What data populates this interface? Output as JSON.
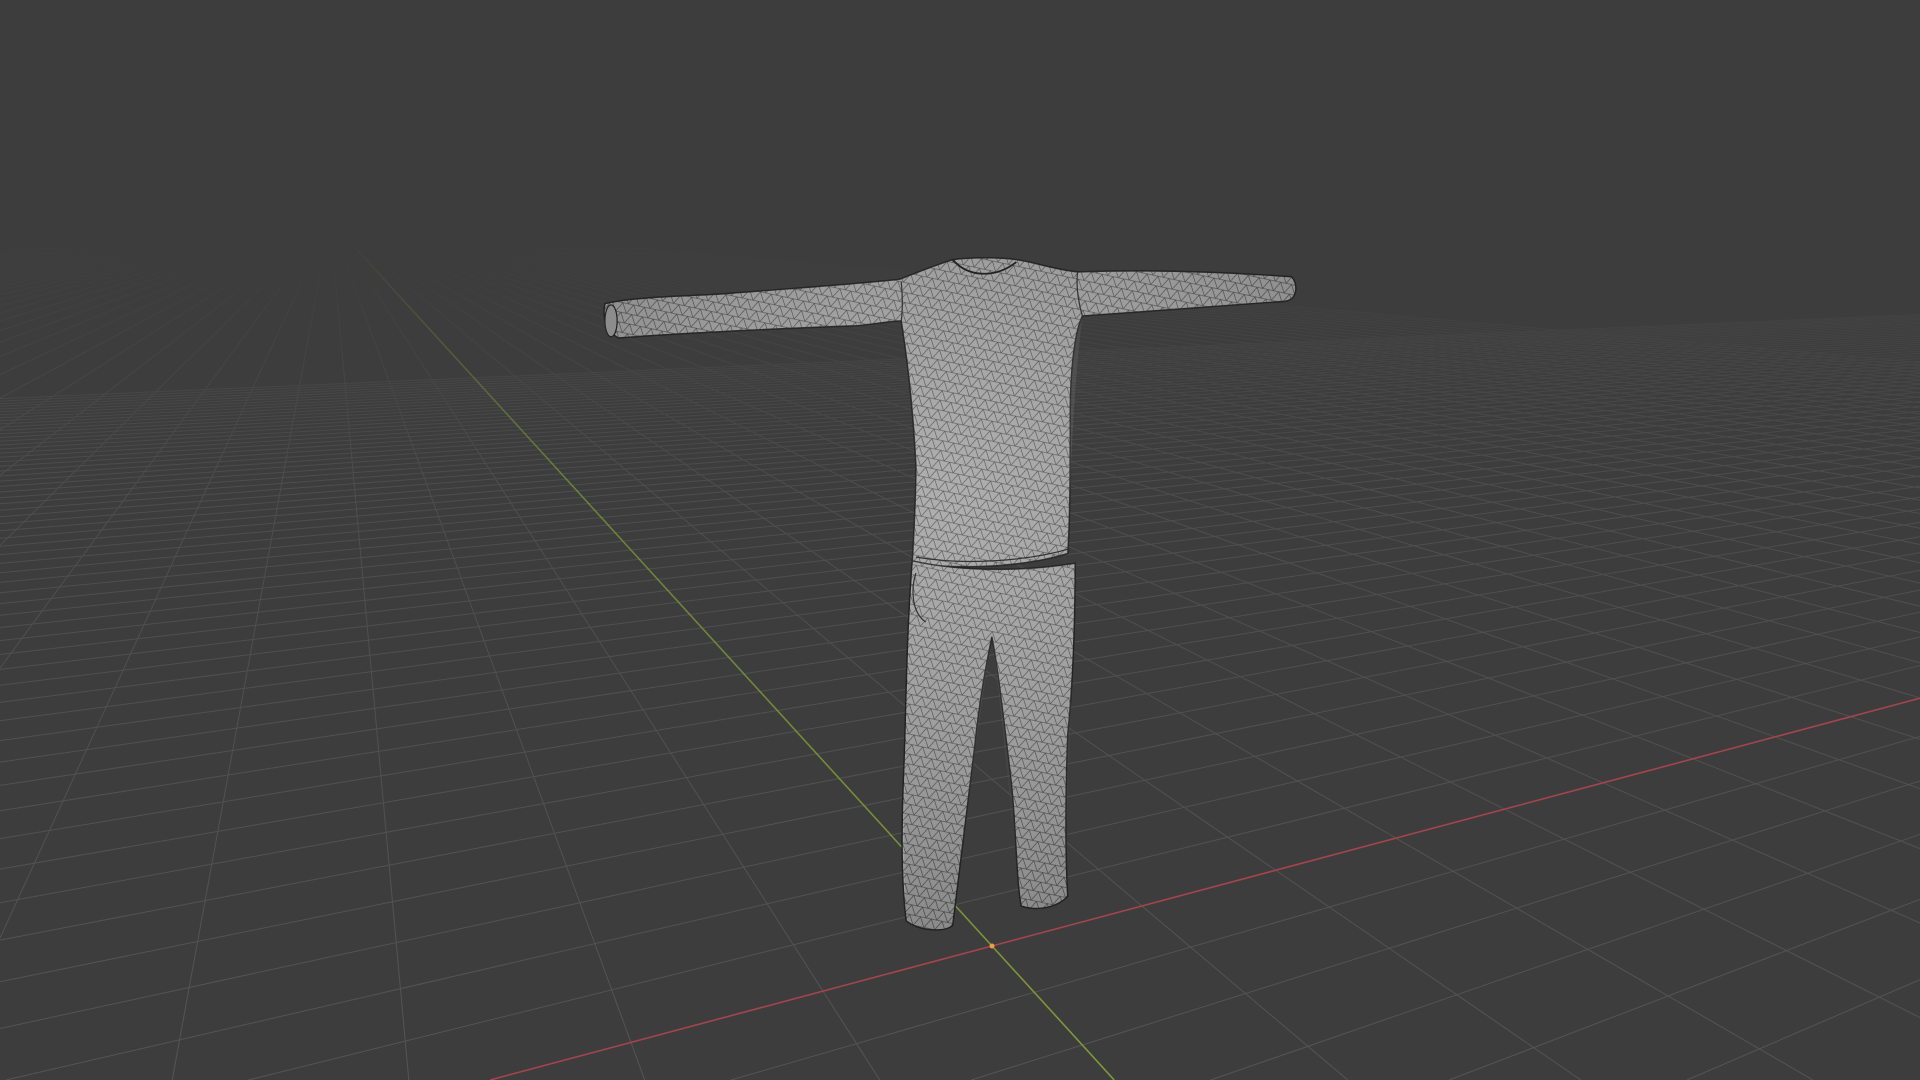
{
  "viewport": {
    "background": "#3d3d3d",
    "grid_color": "#555555",
    "x_axis_color": "#a3454c",
    "y_axis_color": "#7f9a38",
    "mesh_fill": "#a2a2a2",
    "mesh_wire": "#2a2a2a",
    "origin_color": "#e8a040"
  }
}
